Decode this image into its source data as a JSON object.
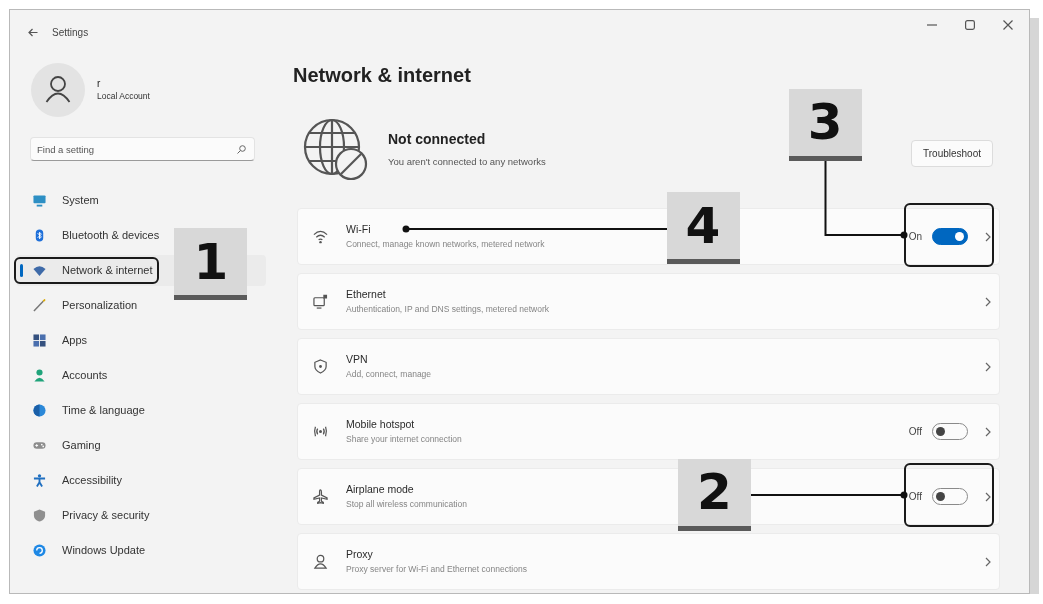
{
  "window": {
    "title": "Settings"
  },
  "account": {
    "name": "r",
    "type": "Local Account"
  },
  "search": {
    "placeholder": "Find a setting"
  },
  "sidebar": {
    "items": [
      {
        "label": "System",
        "selected": false
      },
      {
        "label": "Bluetooth & devices",
        "selected": false
      },
      {
        "label": "Network & internet",
        "selected": true,
        "callout": {
          "label": "1",
          "kind": "frame"
        }
      },
      {
        "label": "Personalization",
        "selected": false
      },
      {
        "label": "Apps",
        "selected": false
      },
      {
        "label": "Accounts",
        "selected": false
      },
      {
        "label": "Time & language",
        "selected": false
      },
      {
        "label": "Gaming",
        "selected": false
      },
      {
        "label": "Accessibility",
        "selected": false
      },
      {
        "label": "Privacy & security",
        "selected": false
      },
      {
        "label": "Windows Update",
        "selected": false
      }
    ]
  },
  "page": {
    "title": "Network & internet"
  },
  "status": {
    "title": "Not connected",
    "subtitle": "You aren't connected to any networks",
    "button": "Troubleshoot"
  },
  "settings": [
    {
      "kind": "wifi",
      "title": "Wi-Fi",
      "subtitle": "Connect, manage known networks, metered network",
      "callout": {
        "label": "4",
        "kind": "pointer"
      },
      "toggle": {
        "label": "On",
        "on": true,
        "callout": {
          "label": "3",
          "kind": "elbow"
        }
      }
    },
    {
      "kind": "ethernet",
      "title": "Ethernet",
      "subtitle": "Authentication, IP and DNS settings, metered network"
    },
    {
      "kind": "vpn",
      "title": "VPN",
      "subtitle": "Add, connect, manage"
    },
    {
      "kind": "hotspot",
      "title": "Mobile hotspot",
      "subtitle": "Share your internet connection",
      "toggle": {
        "label": "Off",
        "on": false
      }
    },
    {
      "kind": "airplane",
      "title": "Airplane mode",
      "subtitle": "Stop all wireless communication",
      "toggle": {
        "label": "Off",
        "on": false,
        "callout": {
          "label": "2",
          "kind": "line"
        }
      }
    },
    {
      "kind": "proxy",
      "title": "Proxy",
      "subtitle": "Proxy server for Wi-Fi and Ethernet connections"
    }
  ]
}
